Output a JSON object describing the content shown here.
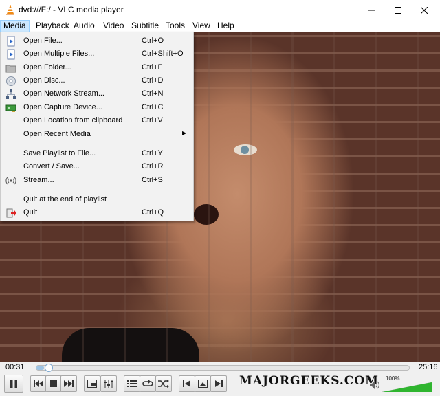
{
  "window": {
    "title": "dvd:///F:/ - VLC media player",
    "icon": "vlc-cone-icon"
  },
  "menubar": {
    "items": [
      {
        "label": "Media",
        "active": true
      },
      {
        "label": "Playback"
      },
      {
        "label": "Audio"
      },
      {
        "label": "Video"
      },
      {
        "label": "Subtitle"
      },
      {
        "label": "Tools"
      },
      {
        "label": "View"
      },
      {
        "label": "Help"
      }
    ]
  },
  "media_menu": {
    "items": [
      {
        "label": "Open File...",
        "shortcut": "Ctrl+O",
        "icon": "open-file-icon"
      },
      {
        "label": "Open Multiple Files...",
        "shortcut": "Ctrl+Shift+O",
        "icon": "open-multiple-files-icon"
      },
      {
        "label": "Open Folder...",
        "shortcut": "Ctrl+F",
        "icon": "folder-icon"
      },
      {
        "label": "Open Disc...",
        "shortcut": "Ctrl+D",
        "icon": "disc-icon"
      },
      {
        "label": "Open Network Stream...",
        "shortcut": "Ctrl+N",
        "icon": "network-icon"
      },
      {
        "label": "Open Capture Device...",
        "shortcut": "Ctrl+C",
        "icon": "capture-card-icon"
      },
      {
        "label": "Open Location from clipboard",
        "shortcut": "Ctrl+V"
      },
      {
        "label": "Open Recent Media",
        "submenu": true
      },
      {
        "label": "Save Playlist to File...",
        "shortcut": "Ctrl+Y"
      },
      {
        "label": "Convert / Save...",
        "shortcut": "Ctrl+R"
      },
      {
        "label": "Stream...",
        "shortcut": "Ctrl+S",
        "icon": "stream-icon"
      },
      {
        "label": "Quit at the end of playlist"
      },
      {
        "label": "Quit",
        "shortcut": "Ctrl+Q",
        "icon": "quit-icon"
      }
    ]
  },
  "player": {
    "elapsed": "00:31",
    "total": "25:16",
    "progress": 0.02,
    "volume_label": "100%",
    "volume": 1.0
  },
  "watermark": "MAJORGEEKS.COM",
  "colors": {
    "menu_highlight": "#cce8ff",
    "volume_green": "#2fb52f",
    "seek_fill": "#9fc4e4"
  }
}
